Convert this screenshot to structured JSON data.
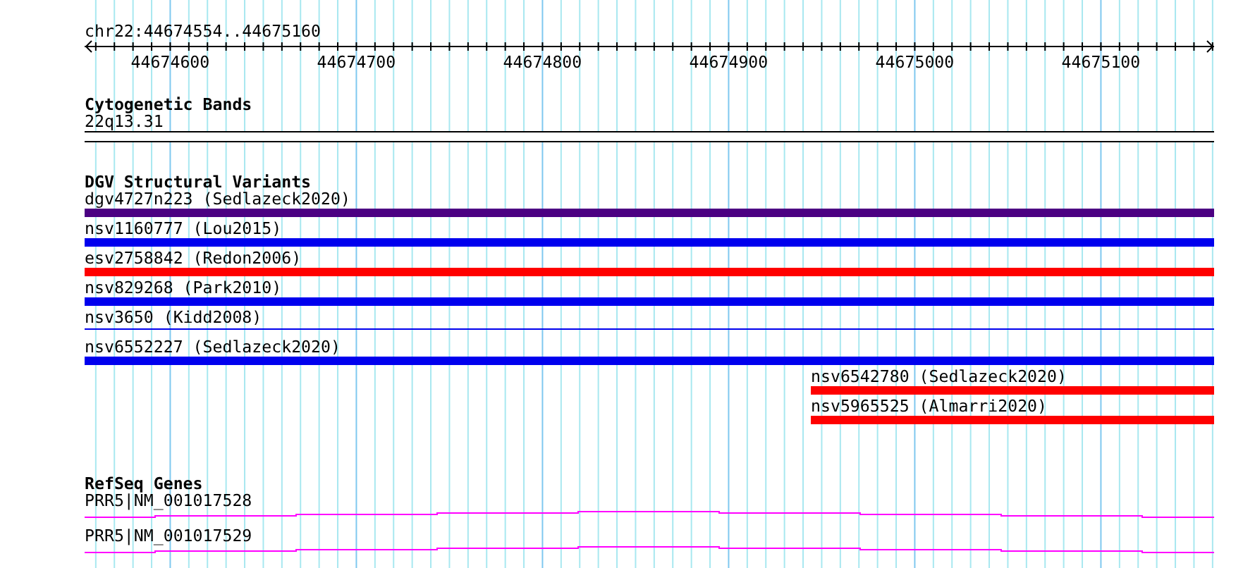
{
  "ruler": {
    "location": "chr22:44674554..44675160",
    "ticks": [
      "44674600",
      "44674700",
      "44674800",
      "44674900",
      "44675000",
      "44675100"
    ]
  },
  "tracks": [
    {
      "kind": "bands",
      "title": "Cytogenetic Bands",
      "items": [
        {
          "label": "22q13.31"
        }
      ]
    },
    {
      "kind": "variants",
      "title": "DGV Structural Variants",
      "items": [
        {
          "label": "dgv4727n223 (Sedlazeck2020)",
          "color": "#4b0082",
          "kind": "bar"
        },
        {
          "label": "nsv1160777 (Lou2015)",
          "color": "#0000ee",
          "kind": "bar"
        },
        {
          "label": "esv2758842 (Redon2006)",
          "color": "#ff0000",
          "kind": "bar"
        },
        {
          "label": "nsv829268 (Park2010)",
          "color": "#0000ee",
          "kind": "bar"
        },
        {
          "label": "nsv3650 (Kidd2008)",
          "color": "#0000ee",
          "kind": "line"
        },
        {
          "label": "nsv6552227 (Sedlazeck2020)",
          "color": "#0000ee",
          "kind": "bar"
        },
        {
          "label": "nsv6542780 (Sedlazeck2020)",
          "color": "#ff0000",
          "kind": "bar"
        },
        {
          "label": "nsv5965525 (Almarri2020)",
          "color": "#ff0000",
          "kind": "bar"
        }
      ]
    },
    {
      "kind": "genes",
      "title": "RefSeq Genes",
      "items": [
        {
          "label": "PRR5|NM_001017528"
        },
        {
          "label": "PRR5|NM_001017529"
        }
      ]
    }
  ]
}
